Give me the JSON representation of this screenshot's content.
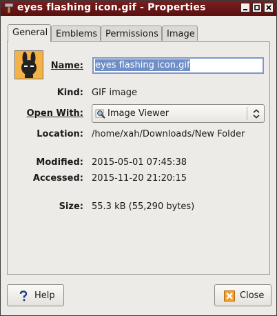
{
  "window": {
    "title": "eyes flashing icon.gif - Properties",
    "buttons": [
      "minimize",
      "maximize",
      "close"
    ]
  },
  "tabs": [
    {
      "label": "General",
      "active": true
    },
    {
      "label": "Emblems",
      "active": false
    },
    {
      "label": "Permissions",
      "active": false
    },
    {
      "label": "Image",
      "active": false
    }
  ],
  "general": {
    "name_label": "Name:",
    "name_value": "eyes flashing icon.gif",
    "kind_label": "Kind:",
    "kind_value": "GIF image",
    "open_with_label": "Open With:",
    "open_with_value": "Image Viewer",
    "location_label": "Location:",
    "location_value": "/home/xah/Downloads/New Folder",
    "modified_label": "Modified:",
    "modified_value": "2015-05-01 07:45:38",
    "accessed_label": "Accessed:",
    "accessed_value": "2015-11-20 21:20:15",
    "size_label": "Size:",
    "size_value": "55.3 kB (55,290 bytes)"
  },
  "footer": {
    "help_label": "Help",
    "close_label": "Close"
  },
  "icons": {
    "title": "hammer-icon",
    "file": "rabbit-thumbnail-icon",
    "open_with": "image-viewer-icon",
    "help": "question-mark-icon",
    "close": "close-x-icon"
  },
  "colors": {
    "titlebar": "#6a1717",
    "selection": "#6f8fc6",
    "focus_border": "#7b98c8",
    "dialog_bg": "#ecebe7"
  }
}
